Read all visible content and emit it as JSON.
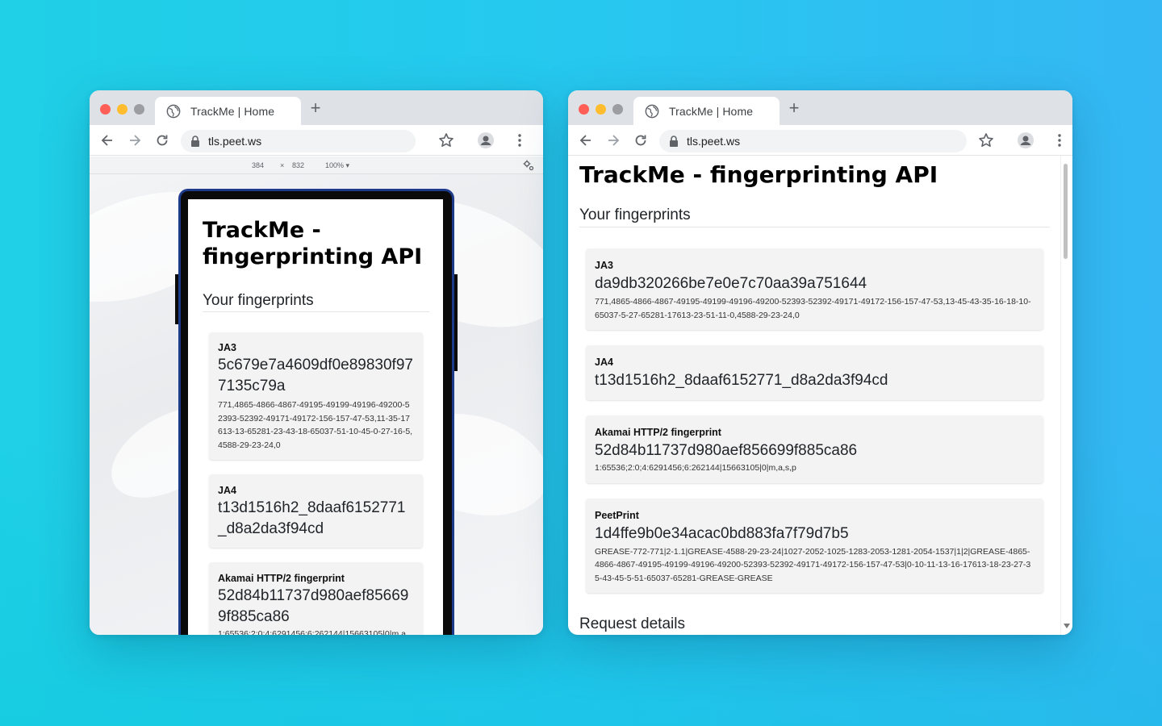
{
  "colors": {
    "background_start": "#1fd0e6",
    "background_end": "#35b7f4",
    "phone_frame": "#1e3a8a",
    "traffic_red": "#ff5f57",
    "traffic_yellow": "#febc2e"
  },
  "browser": {
    "tab_title": "TrackMe | Home",
    "url": "tls.peet.ws",
    "new_tab": "+"
  },
  "devtools": {
    "width": "384",
    "times": "×",
    "height": "832",
    "zoom": "100%"
  },
  "page": {
    "title": "TrackMe - fingerprinting API",
    "title_line1": "TrackMe -",
    "title_line2": "fingerprinting API",
    "section_fingerprints": "Your fingerprints",
    "section_request": "Request details",
    "ja3": {
      "label": "JA3",
      "hash_desktop": "da9db320266be7e0e7c70aa39a751644",
      "raw_desktop": "771,4865-4866-4867-49195-49199-49196-49200-52393-52392-49171-49172-156-157-47-53,13-45-43-35-16-18-10-65037-5-27-65281-17613-23-51-11-0,4588-29-23-24,0",
      "hash_mobile": "5c679e7a4609df0e89830f977135c79a",
      "raw_mobile": "771,4865-4866-4867-49195-49199-49196-49200-52393-52392-49171-49172-156-157-47-53,11-35-17613-13-65281-23-43-18-65037-51-10-45-0-27-16-5,4588-29-23-24,0"
    },
    "ja4": {
      "label": "JA4",
      "hash": "t13d1516h2_8daaf6152771_d8a2da3f94cd"
    },
    "akamai": {
      "label": "Akamai HTTP/2 fingerprint",
      "hash": "52d84b11737d980aef856699f885ca86",
      "raw": "1:65536;2:0;4:6291456;6:262144|15663105|0|m,a,s,p"
    },
    "peetprint": {
      "label": "PeetPrint",
      "hash": "1d4ffe9b0e34acac0bd883fa7f79d7b5",
      "raw": "GREASE-772-771|2-1.1|GREASE-4588-29-23-24|1027-2052-1025-1283-2053-1281-2054-1537|1|2|GREASE-4865-4866-4867-49195-49199-49196-49200-52393-52392-49171-49172-156-157-47-53|0-10-11-13-16-17613-18-23-27-35-43-45-5-51-65037-65281-GREASE-GREASE"
    }
  }
}
